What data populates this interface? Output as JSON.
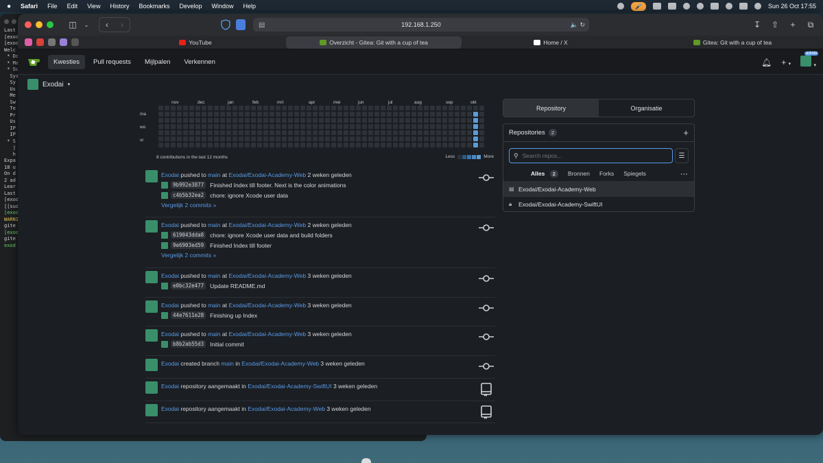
{
  "menubar": {
    "apple": "",
    "app": "Safari",
    "items": [
      "File",
      "Edit",
      "View",
      "History",
      "Bookmarks",
      "Develop",
      "Window",
      "Help"
    ],
    "datetime": "Sun 26 Oct  17:55"
  },
  "terminal": {
    "lines": [
      "Last",
      "[exod",
      "[exod",
      "Welc",
      "",
      " * Do",
      " * Ma",
      " * Su",
      "",
      "  Sys",
      "",
      "  Sy",
      "  Us",
      "  Me",
      "  Sw",
      "  Te",
      "  Pr",
      "  Us",
      "  IP",
      "  IP",
      "",
      " * S",
      "   j",
      "",
      "   h",
      "",
      "Expa",
      "",
      "18 u",
      "On d",
      "",
      "2 ad",
      "Lear",
      "",
      "",
      "Last",
      "[exod",
      "[[sud",
      "[exod",
      "WARNI",
      "gite",
      "[exod",
      "gite",
      "exod"
    ]
  },
  "browser": {
    "url": "192.168.1.250",
    "tabs": [
      {
        "label": "YouTube"
      },
      {
        "label": "Overzicht - Gitea: Git with a cup of tea"
      },
      {
        "label": "Home / X"
      },
      {
        "label": "Gitea: Git with a cup of tea"
      }
    ]
  },
  "gitea": {
    "nav": [
      "Kwesties",
      "Pull requests",
      "Mijlpalen",
      "Verkennen"
    ],
    "user_badge": "admin",
    "context_user": "Exodai",
    "heatmap": {
      "months": [
        "nov",
        "dec",
        "jan",
        "feb",
        "mrt",
        "apr",
        "mei",
        "jun",
        "jul",
        "aug",
        "sep",
        "okt"
      ],
      "days": [
        "ma",
        "wo",
        "vr"
      ],
      "summary": "8 contributions in the last 12 months",
      "less": "Less",
      "more": "More",
      "active_color": "#5b9bd5"
    },
    "feed": [
      {
        "user": "Exodai",
        "action": "pushed to",
        "target": "main",
        "prep": "at",
        "repo": "Exodai/Exodai-Academy-Web",
        "time": "2 weken geleden",
        "commits": [
          {
            "sha": "9b992e3877",
            "msg": "Finished Index till footer. Next is the color animations"
          },
          {
            "sha": "c4b5b32ea2",
            "msg": "chore: ignore Xcode user data"
          }
        ],
        "compare": "Vergelijk 2 commits »",
        "icon": "commit-icon"
      },
      {
        "user": "Exodai",
        "action": "pushed to",
        "target": "main",
        "prep": "at",
        "repo": "Exodai/Exodai-Academy-Web",
        "time": "2 weken geleden",
        "commits": [
          {
            "sha": "619043dda8",
            "msg": "chore: ignore Xcode user data and build folders"
          },
          {
            "sha": "9e6903ed59",
            "msg": "Finished Index till footer"
          }
        ],
        "compare": "Vergelijk 2 commits »",
        "icon": "commit-icon"
      },
      {
        "user": "Exodai",
        "action": "pushed to",
        "target": "main",
        "prep": "at",
        "repo": "Exodai/Exodai-Academy-Web",
        "time": "3 weken geleden",
        "commits": [
          {
            "sha": "e0bc32e477",
            "msg": "Update README.md"
          }
        ],
        "compare": "",
        "icon": "commit-icon"
      },
      {
        "user": "Exodai",
        "action": "pushed to",
        "target": "main",
        "prep": "at",
        "repo": "Exodai/Exodai-Academy-Web",
        "time": "3 weken geleden",
        "commits": [
          {
            "sha": "44e7611e28",
            "msg": "Finishing up Index"
          }
        ],
        "compare": "",
        "icon": "commit-icon"
      },
      {
        "user": "Exodai",
        "action": "pushed to",
        "target": "main",
        "prep": "at",
        "repo": "Exodai/Exodai-Academy-Web",
        "time": "3 weken geleden",
        "commits": [
          {
            "sha": "b8b2ab55d3",
            "msg": "Initial commit"
          }
        ],
        "compare": "",
        "icon": "commit-icon"
      },
      {
        "user": "Exodai",
        "action": "created branch",
        "target": "main",
        "prep": "in",
        "repo": "Exodai/Exodai-Academy-Web",
        "time": "3 weken geleden",
        "commits": [],
        "compare": "",
        "icon": "commit-icon"
      },
      {
        "user": "Exodai",
        "action": "repository aangemaakt in",
        "target": "",
        "prep": "",
        "repo": "Exodai/Exodai-Academy-SwiftUI",
        "time": "3 weken geleden",
        "commits": [],
        "compare": "",
        "icon": "repo-icon"
      },
      {
        "user": "Exodai",
        "action": "repository aangemaakt in",
        "target": "",
        "prep": "",
        "repo": "Exodai/Exodai-Academy-Web",
        "time": "3 weken geleden",
        "commits": [],
        "compare": "",
        "icon": "repo-icon"
      }
    ],
    "sidebar": {
      "tabs": [
        "Repository",
        "Organisatie"
      ],
      "repos_title": "Repositories",
      "repos_count": "2",
      "search_placeholder": "Search repos...",
      "filter_tabs": [
        "Alles",
        "Bronnen",
        "Forks",
        "Spiegels"
      ],
      "alles_count": "2",
      "repos": [
        {
          "name": "Exodai/Exodai-Academy-Web",
          "icon": "repo-icon"
        },
        {
          "name": "Exodai/Exodai-Academy-SwiftUI",
          "icon": "lock-icon"
        }
      ]
    }
  }
}
